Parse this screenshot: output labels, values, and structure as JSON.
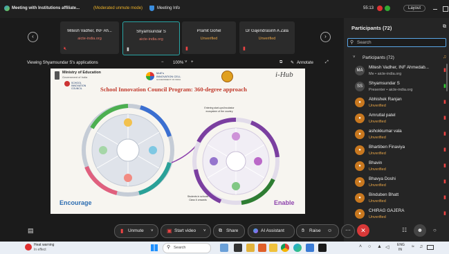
{
  "titlebar": {
    "meeting_title": "Meeting with Institutions affiliate...",
    "mode_badge": "(Moderated unmute mode)",
    "meeting_info": "Meeting Info",
    "timer": "55:13",
    "layout_label": "Layout"
  },
  "thumbnails": [
    {
      "name": "Mitesh Vadher, INF Ah...",
      "sub": "aicte-india.org"
    },
    {
      "name": "Shyamsundar S",
      "sub": "aicte-india.org"
    },
    {
      "name": "Pramit Gohel",
      "sub": "Unverified"
    },
    {
      "name": "Dr Gajendrasinh A Zala",
      "sub": "Unverified"
    }
  ],
  "sharebar": {
    "viewing_label": "Viewing Shyamsundar S's applications",
    "zoom": "100%",
    "annotate_label": "Annotate"
  },
  "slide": {
    "ministry": "Ministry of Education",
    "ministry_sub": "Government of India",
    "school_council": "SCHOOL INNOVATION COUNCIL",
    "moe_cell": "MoE's INNOVATION CELL",
    "moe_cell_sub": "GOVERNMENT OF INDIA",
    "ihub": "i-Hub",
    "title": "School Innovation Council Program: 360-degree approach",
    "left_caption": "Encourage",
    "right_caption": "Enable",
    "note_top": "Entering start-ups/Incubator ecosystem of the country",
    "note_bottom": "Students in schools Class 6 onwards"
  },
  "participants": {
    "header": "Participants (72)",
    "search_placeholder": "Search",
    "group_label": "Participants (72)",
    "items": [
      {
        "initials": "MA",
        "name": "Mitesh Vadher, INF Ahmedab...",
        "status": "Me • aicte-india.org"
      },
      {
        "initials": "SS",
        "name": "Shyamsundar S",
        "status": "Presenter • aicte-india.org"
      },
      {
        "initials": "",
        "name": "Abhishek Ranjan",
        "status": "Unverified"
      },
      {
        "initials": "",
        "name": "Amrutlal patel",
        "status": "Unverified"
      },
      {
        "initials": "",
        "name": "ashokkumar vala",
        "status": "Unverified"
      },
      {
        "initials": "",
        "name": "Bhartiben Finaviya",
        "status": "Unverified"
      },
      {
        "initials": "",
        "name": "Bhavin",
        "status": "Unverified"
      },
      {
        "initials": "",
        "name": "Bhavya Doshi",
        "status": "Unverified"
      },
      {
        "initials": "",
        "name": "Binduben Bhatt",
        "status": "Unverified"
      },
      {
        "initials": "",
        "name": "CHIRAG GAJERA",
        "status": "Unverified"
      }
    ]
  },
  "toolbar": {
    "unmute": "Unmute",
    "start_video": "Start video",
    "share": "Share",
    "ai_assistant": "AI Assistant",
    "raise": "Raise"
  },
  "taskbar": {
    "weather_title": "Heat warning",
    "weather_sub": "In effect",
    "search_placeholder": "Search",
    "lang_top": "ENG",
    "lang_bottom": "IN"
  },
  "colors": {
    "accent": "#2a8c9a",
    "leave_red": "#d93838",
    "unverified": "#e8a547",
    "slide_title": "#c0392b"
  }
}
